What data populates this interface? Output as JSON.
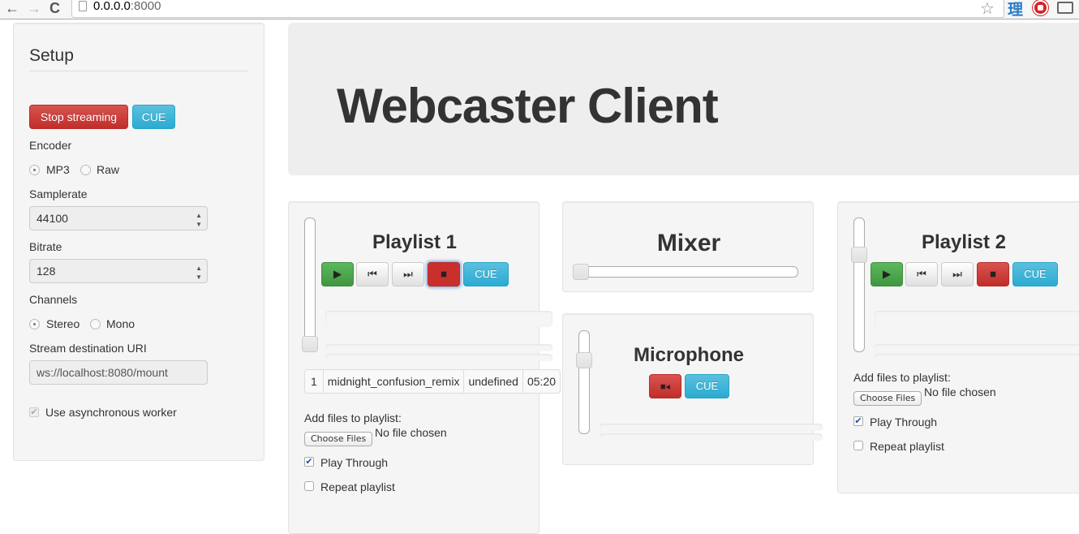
{
  "browser": {
    "url_host": "0.0.0.0",
    "url_port": ":8000",
    "icons": [
      "back-icon",
      "forward-icon",
      "reload-icon",
      "page-icon",
      "bookmark-star-icon",
      "translate-extension-icon",
      "adblock-extension-icon",
      "cast-icon"
    ],
    "ext_translate_glyph": "理",
    "back_glyph": "←",
    "forward_glyph": "→",
    "reload_glyph": "C",
    "star_glyph": "☆"
  },
  "setup": {
    "title": "Setup",
    "stop_label": "Stop streaming",
    "cue_label": "CUE",
    "encoder_label": "Encoder",
    "encoder_options": [
      "MP3",
      "Raw"
    ],
    "encoder_selected": "MP3",
    "samplerate_label": "Samplerate",
    "samplerate_value": "44100",
    "bitrate_label": "Bitrate",
    "bitrate_value": "128",
    "channels_label": "Channels",
    "channels_options": [
      "Stereo",
      "Mono"
    ],
    "channels_selected": "Stereo",
    "uri_label": "Stream destination URI",
    "uri_value": "ws://localhost:8080/mount",
    "async_label": "Use asynchronous worker",
    "async_checked": true
  },
  "header": {
    "title": "Webcaster Client"
  },
  "playlist1": {
    "title": "Playlist 1",
    "volume": 0,
    "cue_label": "CUE",
    "tracks": [
      {
        "index": "1",
        "name": "midnight_confusion_remix",
        "artist": "undefined",
        "duration": "05:20"
      }
    ],
    "add_files_label": "Add files to playlist:",
    "choose_files_label": "Choose Files",
    "no_file_label": "No file chosen",
    "play_through_label": "Play Through",
    "play_through_checked": true,
    "repeat_label": "Repeat playlist",
    "repeat_checked": false
  },
  "mixer": {
    "title": "Mixer",
    "position": 0
  },
  "microphone": {
    "title": "Microphone",
    "cue_label": "CUE",
    "volume": 0.75
  },
  "playlist2": {
    "title": "Playlist 2",
    "volume": 0.75,
    "cue_label": "CUE",
    "add_files_label": "Add files to playlist:",
    "choose_files_label": "Choose Files",
    "no_file_label": "No file chosen",
    "play_through_label": "Play Through",
    "play_through_checked": true,
    "repeat_label": "Repeat playlist",
    "repeat_checked": false
  },
  "glyphs": {
    "play": "▶",
    "prev": "⏮",
    "next": "⏭",
    "stop": "■",
    "camera": "■◂",
    "check": "✔"
  },
  "colors": {
    "danger": "#d9534f",
    "info": "#5bc0de",
    "success": "#5cb85c"
  }
}
